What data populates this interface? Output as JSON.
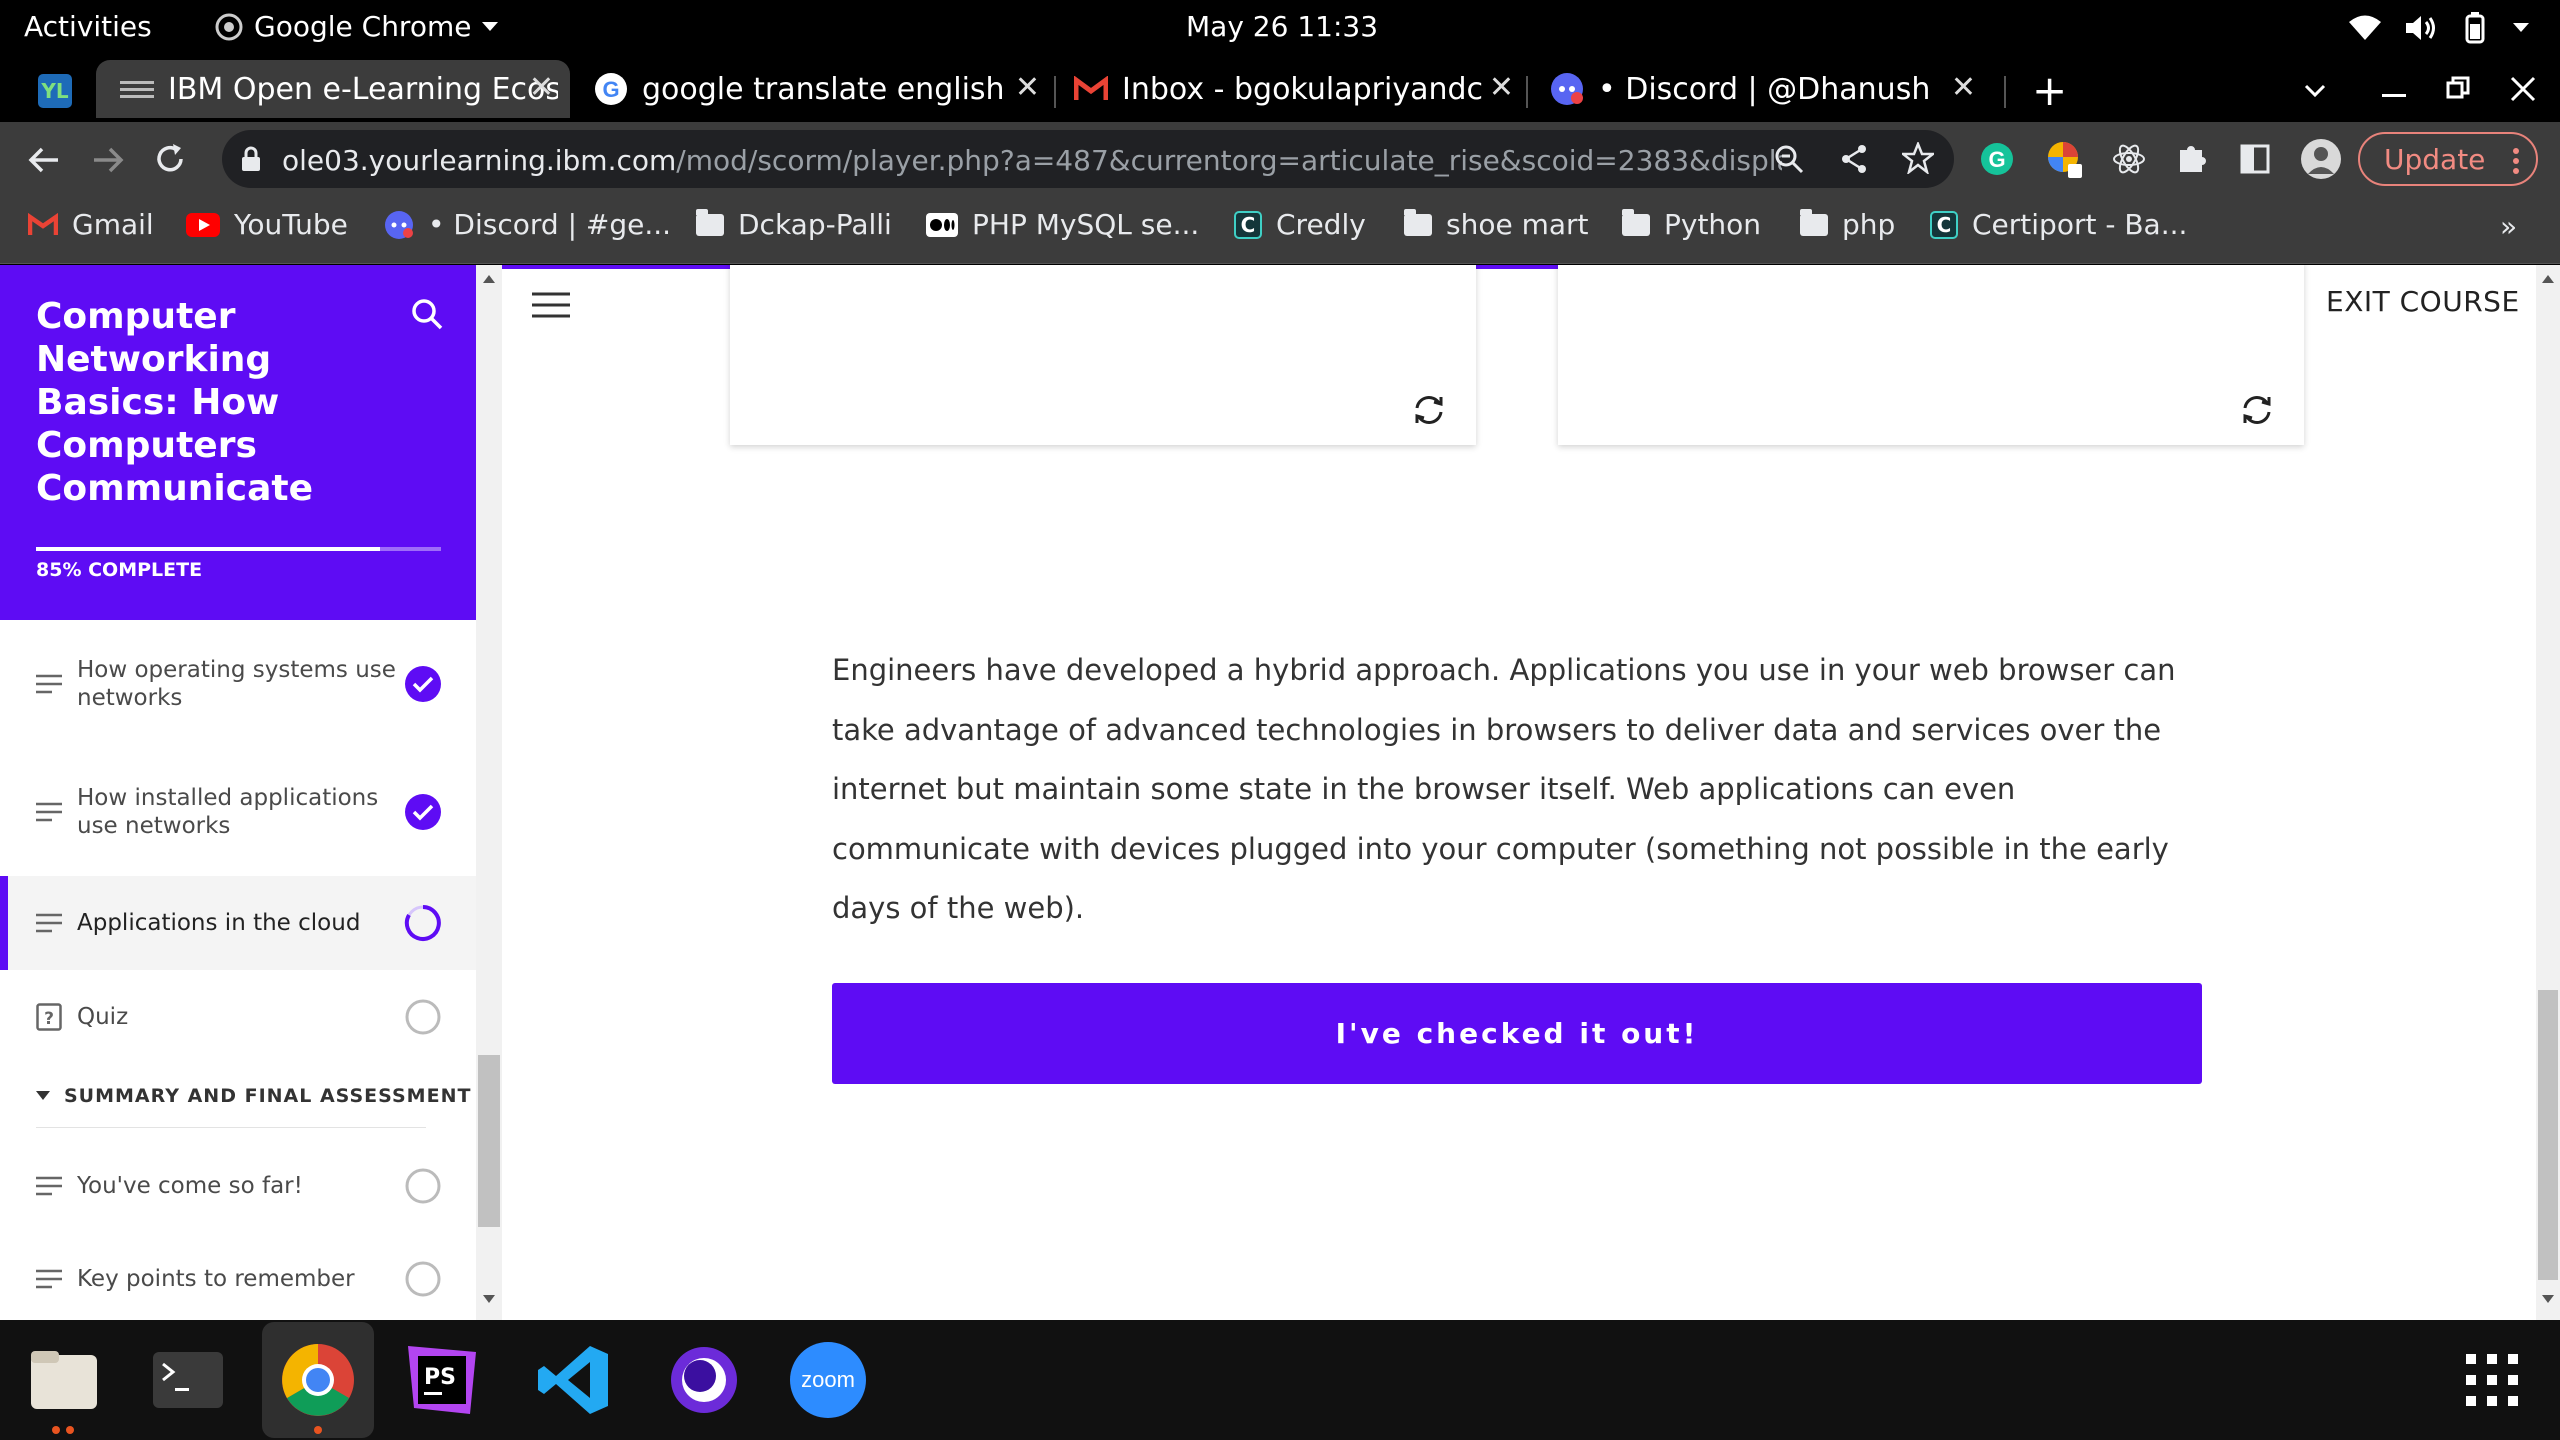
{
  "system": {
    "activities": "Activities",
    "app_name": "Google Chrome",
    "clock": "May 26  11:33"
  },
  "tabs": [
    {
      "title": "IBM Open e-Learning Ecos",
      "active": true
    },
    {
      "title": "google translate english t",
      "active": false
    },
    {
      "title": "Inbox - bgokulapriyandcka",
      "active": false
    },
    {
      "title": "• Discord | @Dhanush",
      "active": false
    }
  ],
  "toolbar": {
    "url_host": "ole03.yourlearning.ibm.com",
    "url_path": "/mod/scorm/player.php?a=487&currentorg=articulate_rise&scoid=2383&display=pop...",
    "update_label": "Update"
  },
  "bookmarks": [
    {
      "label": "Gmail",
      "icon": "gmail-icon"
    },
    {
      "label": "YouTube",
      "icon": "youtube-icon"
    },
    {
      "label": "• Discord | #ge...",
      "icon": "discord-icon"
    },
    {
      "label": "Dckap-Palli",
      "icon": "folder-icon"
    },
    {
      "label": "PHP MySQL se...",
      "icon": "medium-icon"
    },
    {
      "label": "Credly",
      "icon": "credly-icon"
    },
    {
      "label": "shoe mart",
      "icon": "folder-icon"
    },
    {
      "label": "Python",
      "icon": "folder-icon"
    },
    {
      "label": "php",
      "icon": "folder-icon"
    },
    {
      "label": "Certiport - Ba...",
      "icon": "certiport-icon"
    }
  ],
  "course": {
    "title": "Computer Networking Basics: How Computers Communicate",
    "progress_percent": 85,
    "progress_label": "85% COMPLETE",
    "exit_label": "EXIT COURSE",
    "accent_color": "#5e0cf4"
  },
  "lessons": [
    {
      "label": "How operating systems use networks",
      "icon": "lines-icon",
      "status": "complete"
    },
    {
      "label": "How installed applications use networks",
      "icon": "lines-icon",
      "status": "complete"
    },
    {
      "label": "Applications in the cloud",
      "icon": "lines-icon",
      "status": "in-progress"
    },
    {
      "label": "Quiz",
      "icon": "quiz-icon",
      "status": "not-started"
    }
  ],
  "section": {
    "title": "SUMMARY AND FINAL ASSESSMENT",
    "lessons": [
      {
        "label": "You've come so far!",
        "icon": "lines-icon",
        "status": "not-started"
      },
      {
        "label": "Key points to remember",
        "icon": "lines-icon",
        "status": "not-started"
      }
    ]
  },
  "content": {
    "body": "Engineers have developed a hybrid approach. Applications you use in your web browser can take advantage of advanced technologies in browsers to deliver data and services over the internet but maintain some state in the browser itself. Web applications can even communicate with devices plugged into your computer (something not possible in the early days of the web).",
    "button_label": "I've checked it out!"
  },
  "dock": {
    "zoom_label": "zoom"
  }
}
